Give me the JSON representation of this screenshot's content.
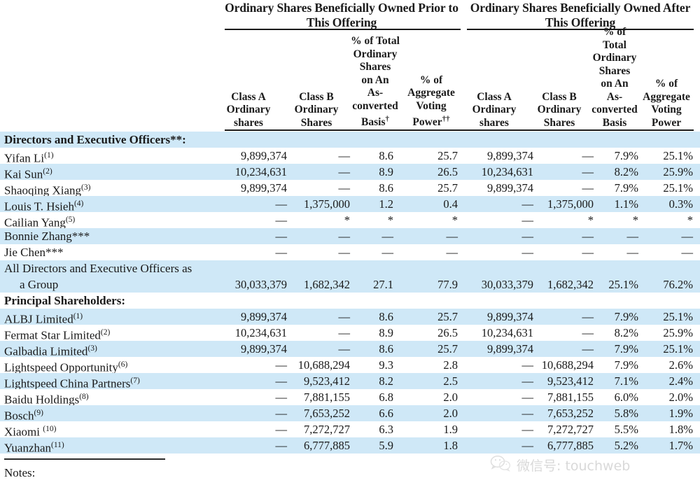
{
  "table": {
    "group_headers": [
      {
        "id": "prior",
        "label": "Ordinary Shares Beneficially Owned Prior to This Offering"
      },
      {
        "id": "after",
        "label": "Ordinary Shares Beneficially Owned After This Offering"
      }
    ],
    "columns": [
      {
        "id": "c1",
        "label": "Class A Ordinary shares",
        "sup": ""
      },
      {
        "id": "c2",
        "label": "Class B Ordinary Shares",
        "sup": ""
      },
      {
        "id": "c3",
        "label": "% of Total Ordinary Shares on An As-converted Basis",
        "sup": "†"
      },
      {
        "id": "c4",
        "label": "% of Aggregate Voting Power",
        "sup": "††"
      },
      {
        "id": "c5",
        "label": "Class A Ordinary shares",
        "sup": ""
      },
      {
        "id": "c6",
        "label": "Class B Ordinary Shares",
        "sup": ""
      },
      {
        "id": "c7",
        "label": "% of Total Ordinary Shares on An As-converted Basis",
        "sup": ""
      },
      {
        "id": "c8",
        "label": "% of Aggregate Voting Power",
        "sup": ""
      }
    ],
    "rows": [
      {
        "kind": "section",
        "stripe": true,
        "name": "Directors and Executive Officers**:",
        "sup": "",
        "values": [
          "",
          "",
          "",
          "",
          "",
          "",
          "",
          ""
        ]
      },
      {
        "kind": "data",
        "stripe": false,
        "name": "Yifan Li",
        "sup": "(1)",
        "values": [
          "9,899,374",
          "—",
          "8.6",
          "25.7",
          "9,899,374",
          "—",
          "7.9%",
          "25.1%"
        ]
      },
      {
        "kind": "data",
        "stripe": true,
        "name": "Kai Sun",
        "sup": "(2)",
        "values": [
          "10,234,631",
          "—",
          "8.9",
          "26.5",
          "10,234,631",
          "—",
          "8.2%",
          "25.9%"
        ]
      },
      {
        "kind": "data",
        "stripe": false,
        "name": "Shaoqing Xiang",
        "sup": "(3)",
        "values": [
          "9,899,374",
          "—",
          "8.6",
          "25.7",
          "9,899,374",
          "—",
          "7.9%",
          "25.1%"
        ]
      },
      {
        "kind": "data",
        "stripe": true,
        "name": "Louis T. Hsieh",
        "sup": "(4)",
        "values": [
          "—",
          "1,375,000",
          "1.2",
          "0.4",
          "—",
          "1,375,000",
          "1.1%",
          "0.3%"
        ]
      },
      {
        "kind": "data",
        "stripe": false,
        "name": "Cailian Yang",
        "sup": "(5)",
        "values": [
          "—",
          "*",
          "*",
          "*",
          "—",
          "*",
          "*",
          "*"
        ]
      },
      {
        "kind": "data",
        "stripe": true,
        "name": "Bonnie Zhang***",
        "sup": "",
        "values": [
          "—",
          "—",
          "—",
          "—",
          "—",
          "—",
          "—",
          "—"
        ]
      },
      {
        "kind": "data",
        "stripe": false,
        "name": "Jie Chen***",
        "sup": "",
        "values": [
          "—",
          "—",
          "—",
          "—",
          "—",
          "—",
          "—",
          "—"
        ]
      },
      {
        "kind": "data-tall",
        "stripe": true,
        "name": "All Directors and Executive Officers as",
        "name_line2": "a Group",
        "sup": "",
        "values": [
          "30,033,379",
          "1,682,342",
          "27.1",
          "77.9",
          "30,033,379",
          "1,682,342",
          "25.1%",
          "76.2%"
        ]
      },
      {
        "kind": "section",
        "stripe": false,
        "name": "Principal Shareholders:",
        "sup": "",
        "values": [
          "",
          "",
          "",
          "",
          "",
          "",
          "",
          ""
        ]
      },
      {
        "kind": "data",
        "stripe": true,
        "name": "ALBJ Limited",
        "sup": "(1)",
        "values": [
          "9,899,374",
          "—",
          "8.6",
          "25.7",
          "9,899,374",
          "—",
          "7.9%",
          "25.1%"
        ]
      },
      {
        "kind": "data",
        "stripe": false,
        "name": "Fermat Star Limited",
        "sup": "(2)",
        "values": [
          "10,234,631",
          "—",
          "8.9",
          "26.5",
          "10,234,631",
          "—",
          "8.2%",
          "25.9%"
        ]
      },
      {
        "kind": "data",
        "stripe": true,
        "name": "Galbadia Limited",
        "sup": "(3)",
        "values": [
          "9,899,374",
          "—",
          "8.6",
          "25.7",
          "9,899,374",
          "—",
          "7.9%",
          "25.1%"
        ]
      },
      {
        "kind": "data",
        "stripe": false,
        "name": "Lightspeed Opportunity",
        "sup": "(6)",
        "values": [
          "—",
          "10,688,294",
          "9.3",
          "2.8",
          "—",
          "10,688,294",
          "7.9%",
          "2.6%"
        ]
      },
      {
        "kind": "data",
        "stripe": true,
        "name": "Lightspeed China Partners",
        "sup": "(7)",
        "values": [
          "—",
          "9,523,412",
          "8.2",
          "2.5",
          "—",
          "9,523,412",
          "7.1%",
          "2.4%"
        ]
      },
      {
        "kind": "data",
        "stripe": false,
        "name": "Baidu Holdings",
        "sup": "(8)",
        "values": [
          "—",
          "7,881,155",
          "6.8",
          "2.0",
          "—",
          "7,881,155",
          "6.0%",
          "2.0%"
        ]
      },
      {
        "kind": "data",
        "stripe": true,
        "name": "Bosch",
        "sup": "(9)",
        "values": [
          "—",
          "7,653,252",
          "6.6",
          "2.0",
          "—",
          "7,653,252",
          "5.8%",
          "1.9%"
        ]
      },
      {
        "kind": "data",
        "stripe": false,
        "name": "Xiaomi ",
        "sup": "(10)",
        "values": [
          "—",
          "7,272,727",
          "6.3",
          "1.9",
          "—",
          "7,272,727",
          "5.5%",
          "1.8%"
        ]
      },
      {
        "kind": "data",
        "stripe": true,
        "name": "Yuanzhan",
        "sup": "(11)",
        "values": [
          "—",
          "6,777,885",
          "5.9",
          "1.8",
          "—",
          "6,777,885",
          "5.2%",
          "1.7%"
        ]
      }
    ]
  },
  "footer": {
    "notes_label": "Notes:"
  },
  "watermark": {
    "text": "微信号: touchweb",
    "icon": "wechat-icon"
  },
  "colors": {
    "stripe": "#cfe8f7",
    "rule": "#1a1a1a",
    "text": "#1a1a1a",
    "watermark": "#d9d9d9"
  }
}
